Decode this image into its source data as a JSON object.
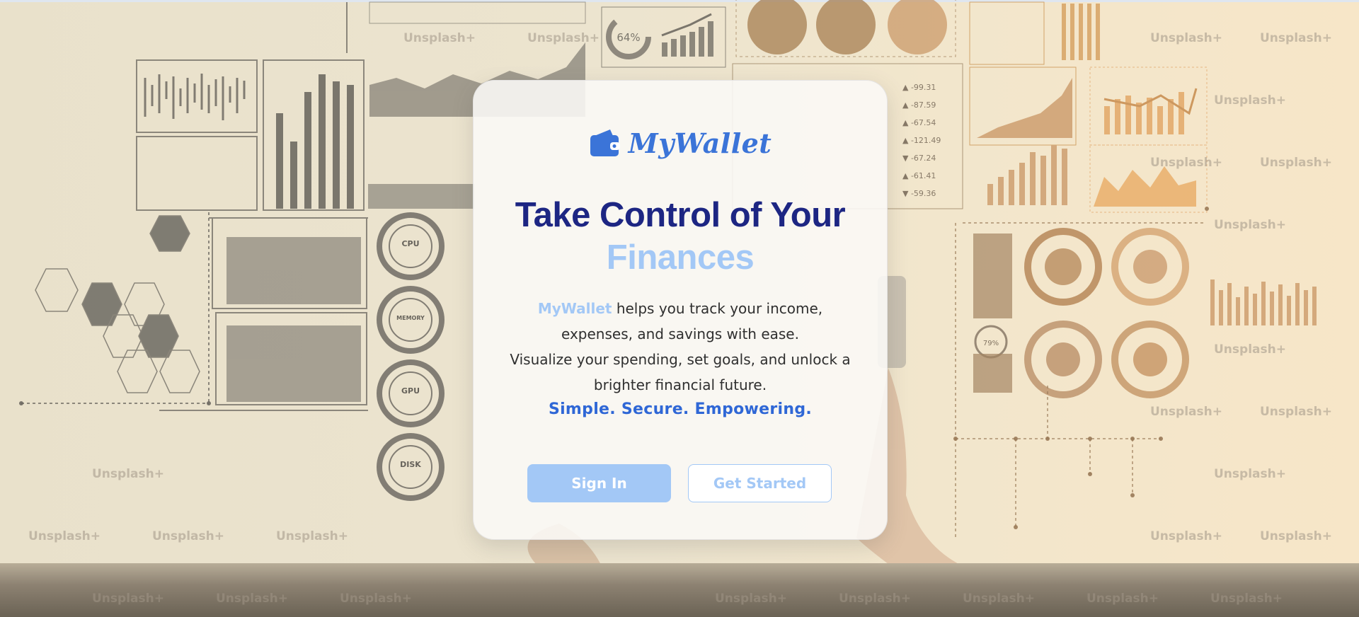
{
  "app": {
    "name": "MyWallet"
  },
  "hero": {
    "title_line1": "Take Control of Your",
    "title_line2": "Finances",
    "description_brand": "MyWallet",
    "description_line1_rest": " helps you track your income,",
    "description_line2": "expenses, and savings with ease.",
    "description_line3": "Visualize your spending, set goals, and unlock a",
    "description_line4": "brighter financial future.",
    "tagline": "Simple. Secure. Empowering."
  },
  "actions": {
    "sign_in": "Sign In",
    "get_started": "Get Started"
  },
  "background": {
    "watermark": "Unsplash+",
    "gauge_labels": [
      "CPU",
      "MEMORY",
      "GPU",
      "DISK"
    ],
    "donut_label": "64%",
    "small_gauge_label": "79%",
    "ticker_values": [
      "-99.31",
      "-87.59",
      "-67.54",
      "-121.49",
      "-67.24",
      "-61.41",
      "-59.36"
    ]
  },
  "colors": {
    "primary": "#3b74d8",
    "headline": "#1d2683",
    "accent_light": "#a3c8f6",
    "tagline": "#2f67d6"
  },
  "icons": {
    "logo": "wallet-icon"
  }
}
